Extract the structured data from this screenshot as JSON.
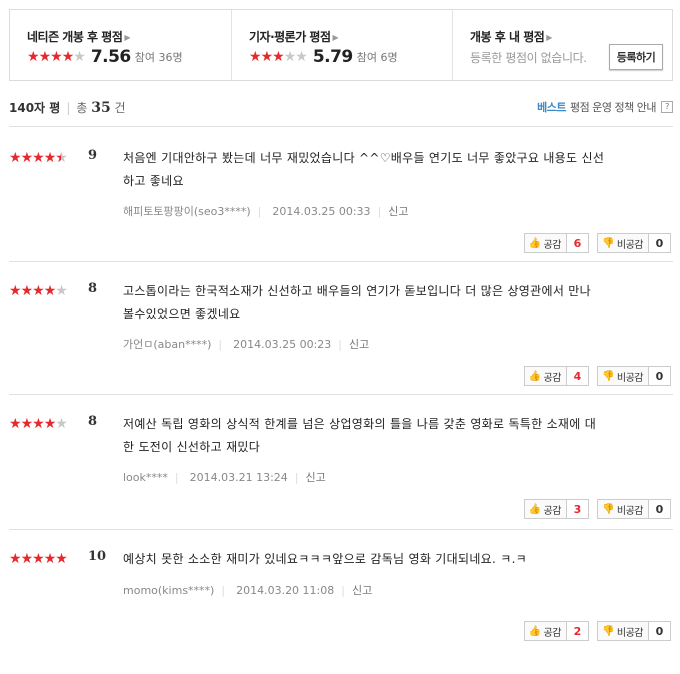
{
  "ratings_box": {
    "netizen": {
      "title": "네티즌 개봉 후 평점",
      "stars": 4,
      "score": "7.56",
      "participants": "참여 36명"
    },
    "critic": {
      "title": "기자·평론가 평점",
      "stars": 3,
      "score": "5.79",
      "participants": "참여 6명"
    },
    "mine": {
      "title": "개봉 후 내 평점",
      "description": "등록한 평점이 없습니다.",
      "register_label": "등록하기"
    }
  },
  "summary": {
    "label": "140자 평",
    "total_prefix": "총",
    "total_count": "35",
    "total_suffix": "건"
  },
  "policy": {
    "best_label": "베스트",
    "text": "평점 운영 정책 안내",
    "help": "?"
  },
  "vote_labels": {
    "like": "공감",
    "dislike": "비공감"
  },
  "reviews": [
    {
      "stars": 4.5,
      "score": "9",
      "lines": [
        "처음엔 기대안하구 봤는데 너무 재밌었습니다 ^^♡배우들 연기도 너무 좋았구요 내용도 신선",
        "하고 좋네요"
      ],
      "author": "해피토토팡팡이(seo3****)",
      "date": "2014.03.25 00:33",
      "report": "신고",
      "likes": "6",
      "dislikes": "0"
    },
    {
      "stars": 4,
      "score": "8",
      "lines": [
        "고스톱이라는 한국적소재가 신선하고 배우들의 연기가 돋보입니다 더 많은 상영관에서 만나",
        "볼수있었으면 좋겠네요"
      ],
      "author": "가언ㅁ(aban****)",
      "date": "2014.03.25 00:23",
      "report": "신고",
      "likes": "4",
      "dislikes": "0"
    },
    {
      "stars": 4,
      "score": "8",
      "lines": [
        "저예산 독립 영화의 상식적 한계를 넘은 상업영화의 틀을 나름 갖춘 영화로 독특한 소재에 대",
        "한 도전이 신선하고 재밌다"
      ],
      "author": "look****",
      "date": "2014.03.21 13:24",
      "report": "신고",
      "likes": "3",
      "dislikes": "0"
    },
    {
      "stars": 5,
      "score": "10",
      "lines": [
        "예상치 못한 소소한 재미가 있네요ㅋㅋㅋ앞으로 감독님 영화 기대되네요. ㅋ.ㅋ"
      ],
      "author": "momo(kims****)",
      "date": "2014.03.20 11:08",
      "report": "신고",
      "likes": "2",
      "dislikes": "0"
    }
  ]
}
